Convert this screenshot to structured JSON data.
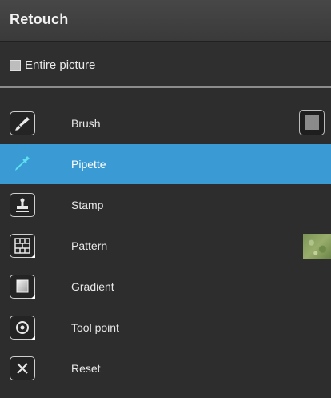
{
  "panel": {
    "title": "Retouch",
    "entire_picture": {
      "label": "Entire picture",
      "checked": false
    }
  },
  "tools": [
    {
      "label": "Brush",
      "icon": "brush-icon",
      "selected": false
    },
    {
      "label": "Pipette",
      "icon": "pipette-icon",
      "selected": true
    },
    {
      "label": "Stamp",
      "icon": "stamp-icon",
      "selected": false
    },
    {
      "label": "Pattern",
      "icon": "pattern-icon",
      "selected": false
    },
    {
      "label": "Gradient",
      "icon": "gradient-icon",
      "selected": false
    },
    {
      "label": "Tool point",
      "icon": "tool-point-icon",
      "selected": false
    },
    {
      "label": "Reset",
      "icon": "reset-icon",
      "selected": false
    }
  ],
  "colors": {
    "selected_row": "#3a9ad3",
    "brush_swatch": "#8a8a8a",
    "pipette_icon": "#5ee0f0"
  }
}
